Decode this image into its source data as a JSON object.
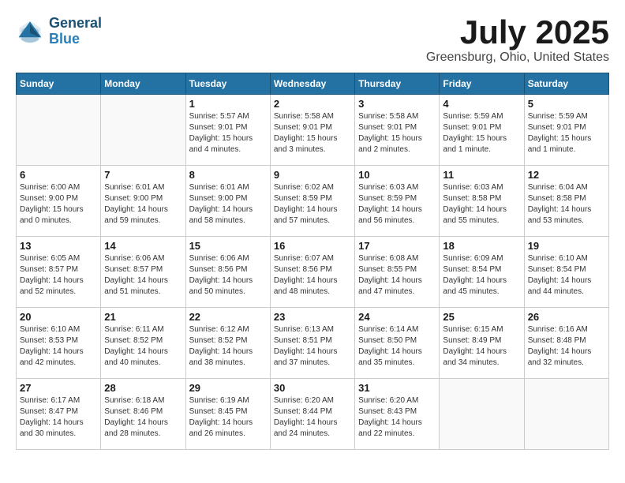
{
  "header": {
    "logo_line1": "General",
    "logo_line2": "Blue",
    "month": "July 2025",
    "location": "Greensburg, Ohio, United States"
  },
  "weekdays": [
    "Sunday",
    "Monday",
    "Tuesday",
    "Wednesday",
    "Thursday",
    "Friday",
    "Saturday"
  ],
  "weeks": [
    [
      {
        "day": "",
        "info": ""
      },
      {
        "day": "",
        "info": ""
      },
      {
        "day": "1",
        "info": "Sunrise: 5:57 AM\nSunset: 9:01 PM\nDaylight: 15 hours\nand 4 minutes."
      },
      {
        "day": "2",
        "info": "Sunrise: 5:58 AM\nSunset: 9:01 PM\nDaylight: 15 hours\nand 3 minutes."
      },
      {
        "day": "3",
        "info": "Sunrise: 5:58 AM\nSunset: 9:01 PM\nDaylight: 15 hours\nand 2 minutes."
      },
      {
        "day": "4",
        "info": "Sunrise: 5:59 AM\nSunset: 9:01 PM\nDaylight: 15 hours\nand 1 minute."
      },
      {
        "day": "5",
        "info": "Sunrise: 5:59 AM\nSunset: 9:01 PM\nDaylight: 15 hours\nand 1 minute."
      }
    ],
    [
      {
        "day": "6",
        "info": "Sunrise: 6:00 AM\nSunset: 9:00 PM\nDaylight: 15 hours\nand 0 minutes."
      },
      {
        "day": "7",
        "info": "Sunrise: 6:01 AM\nSunset: 9:00 PM\nDaylight: 14 hours\nand 59 minutes."
      },
      {
        "day": "8",
        "info": "Sunrise: 6:01 AM\nSunset: 9:00 PM\nDaylight: 14 hours\nand 58 minutes."
      },
      {
        "day": "9",
        "info": "Sunrise: 6:02 AM\nSunset: 8:59 PM\nDaylight: 14 hours\nand 57 minutes."
      },
      {
        "day": "10",
        "info": "Sunrise: 6:03 AM\nSunset: 8:59 PM\nDaylight: 14 hours\nand 56 minutes."
      },
      {
        "day": "11",
        "info": "Sunrise: 6:03 AM\nSunset: 8:58 PM\nDaylight: 14 hours\nand 55 minutes."
      },
      {
        "day": "12",
        "info": "Sunrise: 6:04 AM\nSunset: 8:58 PM\nDaylight: 14 hours\nand 53 minutes."
      }
    ],
    [
      {
        "day": "13",
        "info": "Sunrise: 6:05 AM\nSunset: 8:57 PM\nDaylight: 14 hours\nand 52 minutes."
      },
      {
        "day": "14",
        "info": "Sunrise: 6:06 AM\nSunset: 8:57 PM\nDaylight: 14 hours\nand 51 minutes."
      },
      {
        "day": "15",
        "info": "Sunrise: 6:06 AM\nSunset: 8:56 PM\nDaylight: 14 hours\nand 50 minutes."
      },
      {
        "day": "16",
        "info": "Sunrise: 6:07 AM\nSunset: 8:56 PM\nDaylight: 14 hours\nand 48 minutes."
      },
      {
        "day": "17",
        "info": "Sunrise: 6:08 AM\nSunset: 8:55 PM\nDaylight: 14 hours\nand 47 minutes."
      },
      {
        "day": "18",
        "info": "Sunrise: 6:09 AM\nSunset: 8:54 PM\nDaylight: 14 hours\nand 45 minutes."
      },
      {
        "day": "19",
        "info": "Sunrise: 6:10 AM\nSunset: 8:54 PM\nDaylight: 14 hours\nand 44 minutes."
      }
    ],
    [
      {
        "day": "20",
        "info": "Sunrise: 6:10 AM\nSunset: 8:53 PM\nDaylight: 14 hours\nand 42 minutes."
      },
      {
        "day": "21",
        "info": "Sunrise: 6:11 AM\nSunset: 8:52 PM\nDaylight: 14 hours\nand 40 minutes."
      },
      {
        "day": "22",
        "info": "Sunrise: 6:12 AM\nSunset: 8:52 PM\nDaylight: 14 hours\nand 38 minutes."
      },
      {
        "day": "23",
        "info": "Sunrise: 6:13 AM\nSunset: 8:51 PM\nDaylight: 14 hours\nand 37 minutes."
      },
      {
        "day": "24",
        "info": "Sunrise: 6:14 AM\nSunset: 8:50 PM\nDaylight: 14 hours\nand 35 minutes."
      },
      {
        "day": "25",
        "info": "Sunrise: 6:15 AM\nSunset: 8:49 PM\nDaylight: 14 hours\nand 34 minutes."
      },
      {
        "day": "26",
        "info": "Sunrise: 6:16 AM\nSunset: 8:48 PM\nDaylight: 14 hours\nand 32 minutes."
      }
    ],
    [
      {
        "day": "27",
        "info": "Sunrise: 6:17 AM\nSunset: 8:47 PM\nDaylight: 14 hours\nand 30 minutes."
      },
      {
        "day": "28",
        "info": "Sunrise: 6:18 AM\nSunset: 8:46 PM\nDaylight: 14 hours\nand 28 minutes."
      },
      {
        "day": "29",
        "info": "Sunrise: 6:19 AM\nSunset: 8:45 PM\nDaylight: 14 hours\nand 26 minutes."
      },
      {
        "day": "30",
        "info": "Sunrise: 6:20 AM\nSunset: 8:44 PM\nDaylight: 14 hours\nand 24 minutes."
      },
      {
        "day": "31",
        "info": "Sunrise: 6:20 AM\nSunset: 8:43 PM\nDaylight: 14 hours\nand 22 minutes."
      },
      {
        "day": "",
        "info": ""
      },
      {
        "day": "",
        "info": ""
      }
    ]
  ]
}
